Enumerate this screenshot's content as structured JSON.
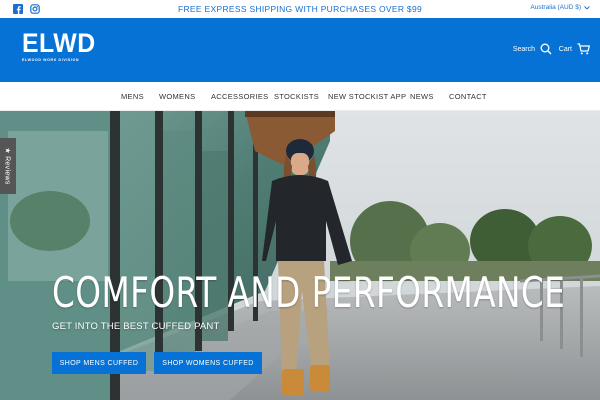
{
  "announcement": {
    "promo": "FREE EXPRESS SHIPPING WITH PURCHASES OVER $99",
    "currency": "Australia (AUD $)",
    "social_icons": [
      "facebook-icon",
      "instagram-icon"
    ]
  },
  "header": {
    "logo": "ELWD",
    "logo_sub": "ELWOOD WORK DIVISION",
    "search_label": "Search",
    "cart_label": "Cart",
    "brand_color": "#0672d6"
  },
  "nav": {
    "items": [
      "MENS",
      "WOMENS",
      "ACCESSORIES",
      "STOCKISTS",
      "NEW STOCKIST APP",
      "NEWS",
      "CONTACT"
    ]
  },
  "hero": {
    "title": "COMFORT AND PERFORMANCE",
    "subtitle": "GET INTO THE BEST CUFFED PANT",
    "buttons": [
      "SHOP MENS CUFFED",
      "SHOP WOMENS CUFFED"
    ]
  },
  "reviews_tab": {
    "label": "★ Reviews"
  }
}
